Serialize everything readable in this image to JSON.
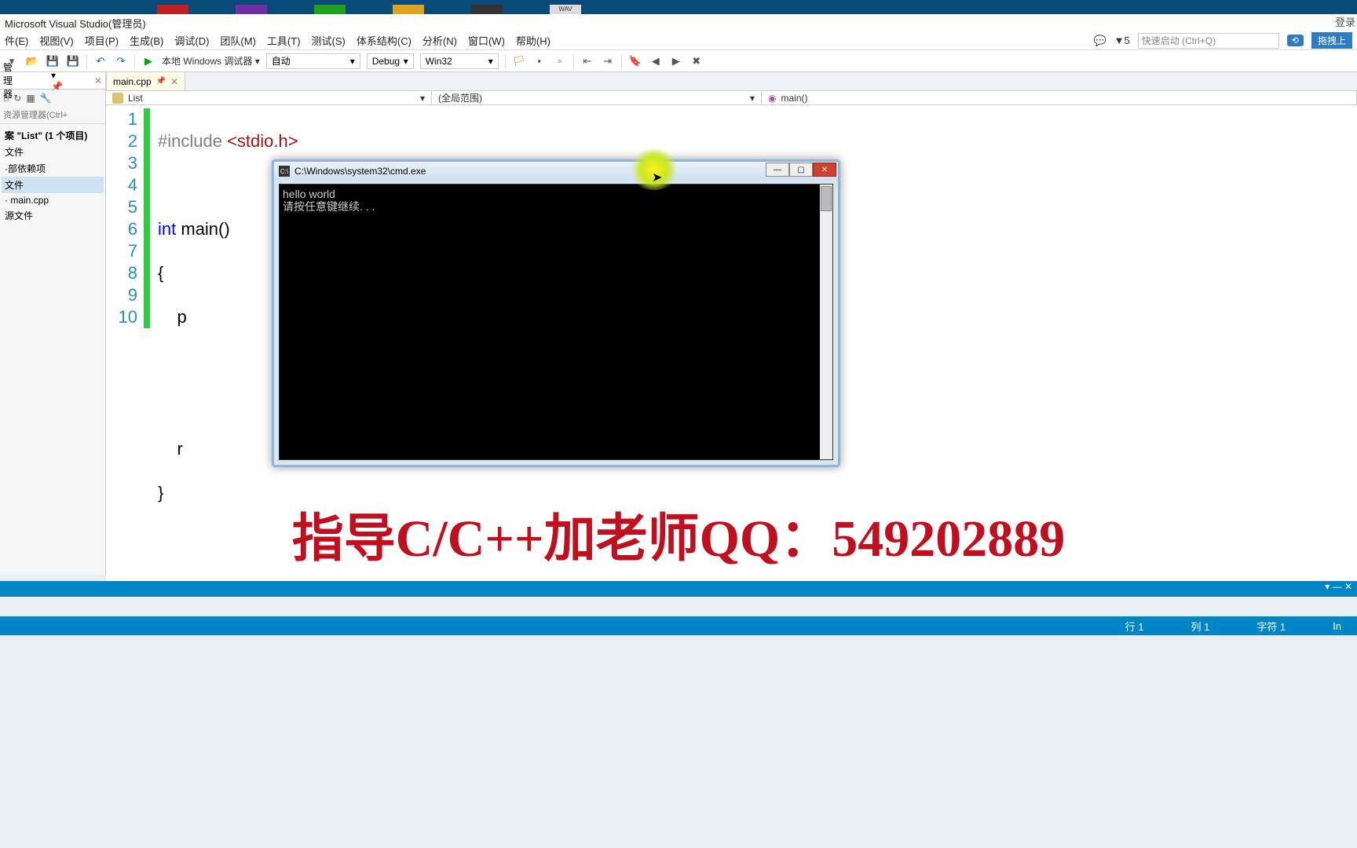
{
  "title": "Microsoft Visual Studio(管理员)",
  "menus": [
    "件(E)",
    "视图(V)",
    "项目(P)",
    "生成(B)",
    "调试(D)",
    "团队(M)",
    "工具(T)",
    "测试(S)",
    "体系结构(C)",
    "分析(N)",
    "窗口(W)",
    "帮助(H)"
  ],
  "login": "登录",
  "notify_count": "5",
  "quick_placeholder": "快速启动 (Ctrl+Q)",
  "toggle_btn": "拖拽上",
  "toolbar": {
    "debugger": "本地 Windows 调试器",
    "auto": "自动",
    "config": "Debug",
    "platform": "Win32"
  },
  "sidebar": {
    "tab": "管理器",
    "search_ph": "资源管理器(Ctrl+",
    "solution": "案 \"List\"  (1 个项目)",
    "nodes": [
      "文件",
      "·部依赖项",
      "文件",
      "· main.cpp",
      "源文件"
    ]
  },
  "file_tab": "main.cpp",
  "scope": {
    "c1": "List",
    "c2": "(全局范围)",
    "c3": "main()"
  },
  "code": {
    "lines": [
      "1",
      "2",
      "3",
      "4",
      "5",
      "6",
      "7",
      "8",
      "9",
      "10"
    ],
    "l1_pp": "#include ",
    "l1_inc": "<stdio.h>",
    "l3_kw": "int",
    "l3_rest": " main()",
    "l4": "{",
    "l5": "    p",
    "l8": "    r",
    "l9": "}"
  },
  "cmd": {
    "title": "C:\\Windows\\system32\\cmd.exe",
    "out1": "hello world",
    "out2": "请按任意键继续. . ."
  },
  "overlay": "指导C/C++加老师QQ：549202889",
  "status": {
    "line": "行 1",
    "col": "列 1",
    "char": "字符 1",
    "ins": "In"
  }
}
